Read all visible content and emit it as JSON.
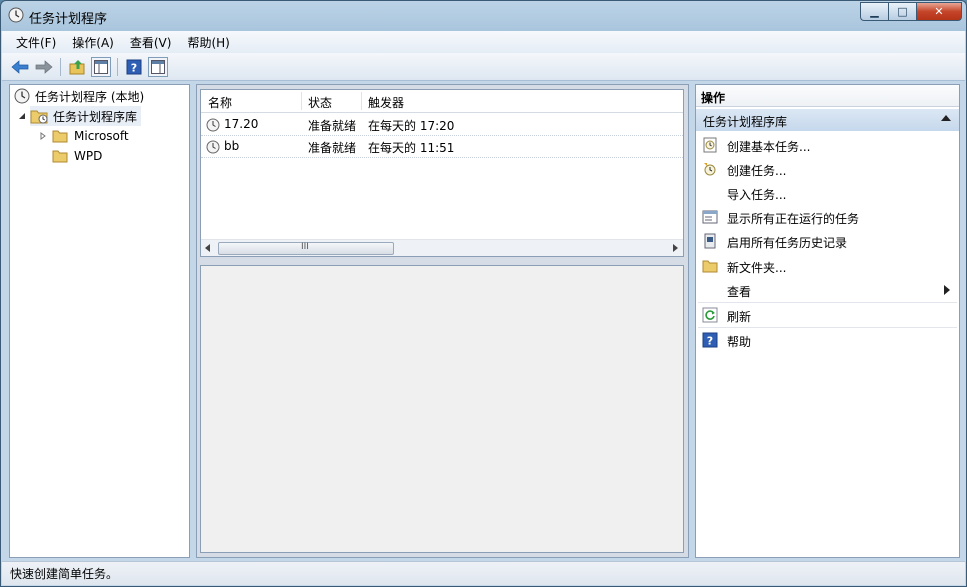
{
  "window": {
    "title": "任务计划程序",
    "minimize_label": "▁",
    "maximize_label": "□",
    "close_label": "✕"
  },
  "menu": [
    {
      "label": "文件(F)"
    },
    {
      "label": "操作(A)"
    },
    {
      "label": "查看(V)"
    },
    {
      "label": "帮助(H)"
    }
  ],
  "toolbar": {
    "icons": [
      "back-arrow-icon",
      "forward-arrow-icon",
      "up-folder-icon",
      "show-hide-console-tree-icon",
      "help-icon",
      "show-hide-action-pane-icon"
    ]
  },
  "tree": {
    "root": "任务计划程序 (本地)",
    "library": "任务计划程序库",
    "children": [
      "Microsoft",
      "WPD"
    ]
  },
  "task_list": {
    "columns": [
      "名称",
      "状态",
      "触发器"
    ],
    "rows": [
      {
        "name": "17.20",
        "status": "准备就绪",
        "trigger": "在每天的 17:20"
      },
      {
        "name": "bb",
        "status": "准备就绪",
        "trigger": "在每天的 11:51"
      }
    ],
    "scroll_grip": "III"
  },
  "actions": {
    "header": "操作",
    "section": "任务计划程序库",
    "items": [
      {
        "label": "创建基本任务...",
        "icon": "create-basic-task-icon"
      },
      {
        "label": "创建任务...",
        "icon": "create-task-icon"
      },
      {
        "label": "导入任务...",
        "icon": ""
      },
      {
        "label": "显示所有正在运行的任务",
        "icon": "running-tasks-icon"
      },
      {
        "label": "启用所有任务历史记录",
        "icon": "history-icon"
      },
      {
        "label": "新文件夹...",
        "icon": "folder-icon"
      },
      {
        "label": "查看",
        "icon": ""
      },
      {
        "label": "刷新",
        "icon": "refresh-icon"
      },
      {
        "label": "帮助",
        "icon": "help-icon"
      }
    ]
  },
  "status_bar": {
    "text": "快速创建简单任务。"
  },
  "colors": {
    "accent": "#c6d8ec",
    "close_button": "#c5452a"
  }
}
